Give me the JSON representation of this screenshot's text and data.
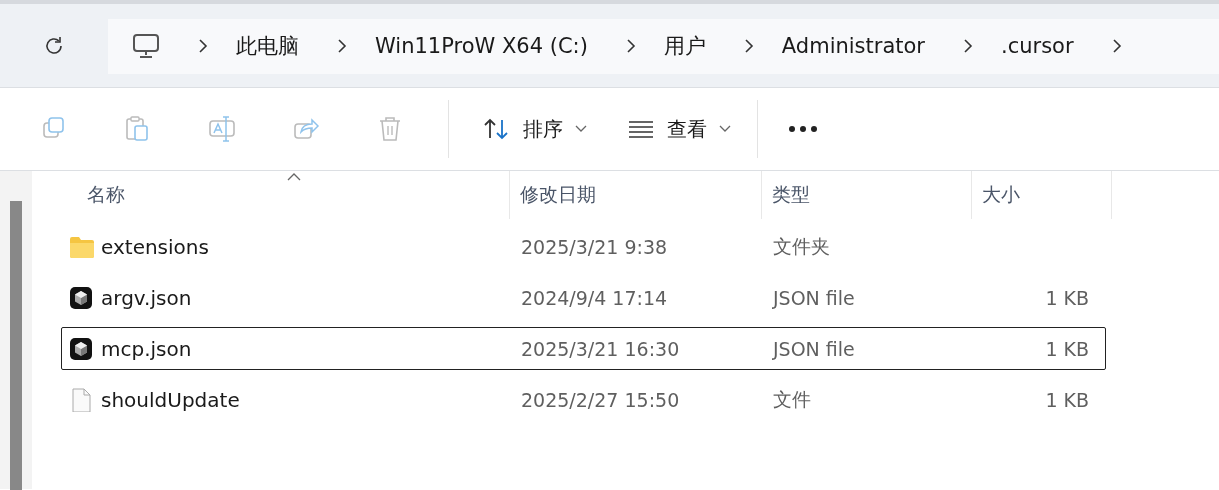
{
  "address_bar": {
    "breadcrumbs": [
      "此电脑",
      "Win11ProW X64 (C:)",
      "用户",
      "Administrator",
      ".cursor"
    ]
  },
  "toolbar": {
    "actions": [
      {
        "kind": "copy",
        "disabled": true
      },
      {
        "kind": "paste",
        "disabled": true
      },
      {
        "kind": "rename",
        "disabled": true
      },
      {
        "kind": "share",
        "disabled": true
      },
      {
        "kind": "delete",
        "disabled": true
      }
    ],
    "menus": [
      {
        "kind": "sort",
        "label": "排序"
      },
      {
        "kind": "view",
        "label": "查看"
      }
    ]
  },
  "file_list": {
    "columns": [
      {
        "label": "名称",
        "sorted": true
      },
      {
        "label": "修改日期",
        "sorted": false
      },
      {
        "label": "类型",
        "sorted": false
      },
      {
        "label": "大小",
        "sorted": false
      }
    ],
    "rows": [
      {
        "kind": "folder",
        "name": "extensions",
        "modified": "2025/3/21 9:38",
        "type": "文件夹",
        "focused": false
      },
      {
        "kind": "json",
        "name": "argv.json",
        "modified": "2024/9/4 17:14",
        "type": "JSON file",
        "size": "1 KB",
        "focused": false
      },
      {
        "kind": "json",
        "name": "mcp.json",
        "modified": "2025/3/21 16:30",
        "type": "JSON file",
        "size": "1 KB",
        "focused": true
      },
      {
        "kind": "file",
        "name": "shouldUpdate",
        "modified": "2025/2/27 15:50",
        "type": "文件",
        "size": "1 KB",
        "focused": false
      }
    ]
  }
}
